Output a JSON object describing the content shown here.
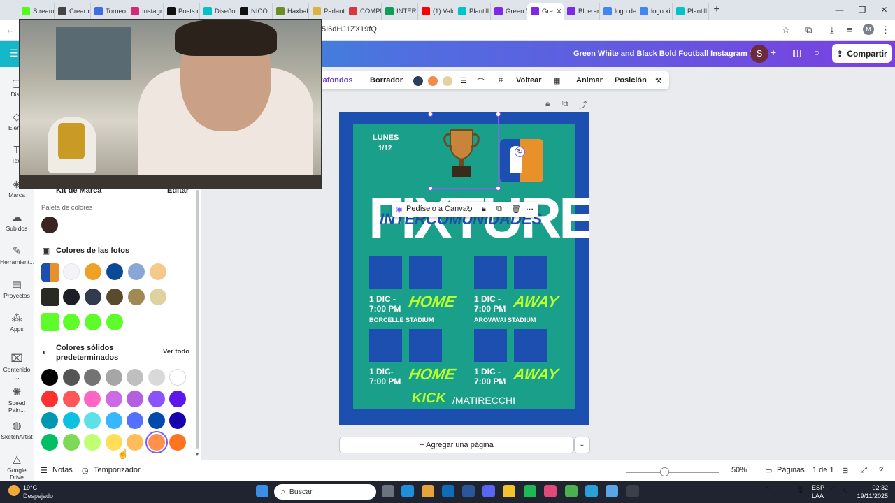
{
  "browser": {
    "tabs": [
      {
        "label": "Stream",
        "color": "#53fc18"
      },
      {
        "label": "Crear m",
        "color": "#444444"
      },
      {
        "label": "Torneo",
        "color": "#3b6ee0"
      },
      {
        "label": "Instagr",
        "color": "#d62976"
      },
      {
        "label": "Posts q",
        "color": "#111111"
      },
      {
        "label": "Diseño",
        "color": "#00c4cc"
      },
      {
        "label": "NICO",
        "color": "#111111"
      },
      {
        "label": "Haxbal",
        "color": "#6b8e23"
      },
      {
        "label": "Parlant",
        "color": "#e0b040"
      },
      {
        "label": "COMPI",
        "color": "#d9363e"
      },
      {
        "label": "INTERC",
        "color": "#0f9d58"
      },
      {
        "label": "(1) Valo",
        "color": "#ff0000"
      },
      {
        "label": "Plantill",
        "color": "#00c4cc"
      },
      {
        "label": "Green V",
        "color": "#7d2ae8"
      },
      {
        "label": "Gre",
        "color": "#7d2ae8"
      },
      {
        "label": "Blue an",
        "color": "#7d2ae8"
      },
      {
        "label": "logo de",
        "color": "#4285f4"
      },
      {
        "label": "logo ki",
        "color": "#4285f4"
      },
      {
        "label": "Plantill",
        "color": "#00c4cc"
      }
    ],
    "active_tab_index": 14,
    "tab_close": "✕",
    "new_tab": "+",
    "window_controls": [
      "—",
      "❐",
      "✕"
    ],
    "url": "5I6dHJ1ZX19fQ",
    "profile_initial": "M"
  },
  "header": {
    "doc_title": "Green White and Black Bold Football Instagram Post",
    "user_initial": "S",
    "share_label": "Compartir"
  },
  "rail": {
    "items": [
      {
        "label": "Dise",
        "icon": "design-icon"
      },
      {
        "label": "Eleme",
        "icon": "elements-icon"
      },
      {
        "label": "Text",
        "icon": "text-icon"
      },
      {
        "label": "Marca",
        "icon": "brand-icon"
      },
      {
        "label": "Subidos",
        "icon": "upload-icon"
      },
      {
        "label": "Herramient...",
        "icon": "tools-icon"
      },
      {
        "label": "Proyectos",
        "icon": "folder-icon"
      },
      {
        "label": "Apps",
        "icon": "apps-icon"
      },
      {
        "label": "Contenido ...",
        "icon": "content-icon"
      },
      {
        "label": "Speed Pain...",
        "icon": "speed-paint-icon"
      },
      {
        "label": "SketchArtist",
        "icon": "sketch-artist-icon"
      },
      {
        "label": "Google Drive",
        "icon": "google-drive-icon"
      }
    ]
  },
  "panel": {
    "kit_label": "Kit de Marca",
    "kit_edit": "Editar",
    "palette_label": "Paleta de colores",
    "palette_colors": [
      "#3b2424"
    ],
    "photo_colors_title": "Colores de las fotos",
    "photo_rows": [
      [
        "#f4f4f6",
        "#efa127",
        "#0c4a98",
        "#88a6d6",
        "#f5c98b"
      ],
      [
        "#1e1e26",
        "#313a4e",
        "#5a4a2e",
        "#a08a52",
        "#ddd2a0"
      ],
      [
        "#5efc28",
        "#5efc28",
        "#5efc28"
      ]
    ],
    "solid_title": "Colores sólidos predeterminados",
    "solid_see_all": "Ver todo",
    "solid_rows": [
      [
        "#000000",
        "#545454",
        "#737373",
        "#a6a6a6",
        "#bfbfbf",
        "#d9d9d9",
        "#ffffff"
      ],
      [
        "#ff3131",
        "#ff5757",
        "#ff66c4",
        "#cb6ce6",
        "#b35fe0",
        "#8c52ff",
        "#5e17eb"
      ],
      [
        "#0097b2",
        "#0cc0df",
        "#5ce1e6",
        "#38b6ff",
        "#5271ff",
        "#004aad",
        "#1800ad"
      ],
      [
        "#00bf63",
        "#7ed957",
        "#c1ff72",
        "#ffde59",
        "#ffbd59",
        "#ff914d",
        "#ff751f"
      ]
    ],
    "selected_solid": "#ff914d"
  },
  "toolbar": {
    "fondos_label": "tafondos",
    "borrador_label": "Borrador",
    "colors": [
      "#2b3d5e",
      "#f38b4a",
      "#e2d4a2"
    ],
    "voltear_label": "Voltear",
    "animar_label": "Animar",
    "posicion_label": "Posición"
  },
  "design": {
    "day": "LUNES",
    "date": "1/12",
    "headline": "FIXTURES",
    "subtitle": "INTERCOMUNIDADES",
    "matches": [
      {
        "when": "1 DIC -",
        "time": "7:00 PM",
        "tag": "HOME",
        "stadium": "BORCELLE STADIUM"
      },
      {
        "when": "1 DIC -",
        "time": "7:00 PM",
        "tag": "AWAY",
        "stadium": "AROWWAI STADIUM"
      },
      {
        "when": "1 DIC-",
        "time": "7:00 PM",
        "tag": "HOME",
        "stadium": ""
      },
      {
        "when": "1 DIC -",
        "time": "7:00 PM",
        "tag": "AWAY",
        "stadium": ""
      }
    ],
    "kick_label": "KICK",
    "channel": "/MATIRECCHI",
    "colors": {
      "frame": "#1d4fb0",
      "inner": "#1aa08a",
      "neon": "#b8ff2e"
    }
  },
  "context_menu": {
    "ask_canva": "Pedíselo a Canva"
  },
  "add_page_label": "+ Agregar una página",
  "bottom": {
    "notes_label": "Notas",
    "timer_label": "Temporizador",
    "zoom": "50%",
    "pages_label": "Páginas",
    "page_count": "1 de 1"
  },
  "taskbar": {
    "temp": "19°C",
    "weather": "Despejado",
    "search_placeholder": "Buscar",
    "lang_1": "ESP",
    "lang_2": "LAA",
    "time": "02:32",
    "date": "19/11/2025"
  }
}
